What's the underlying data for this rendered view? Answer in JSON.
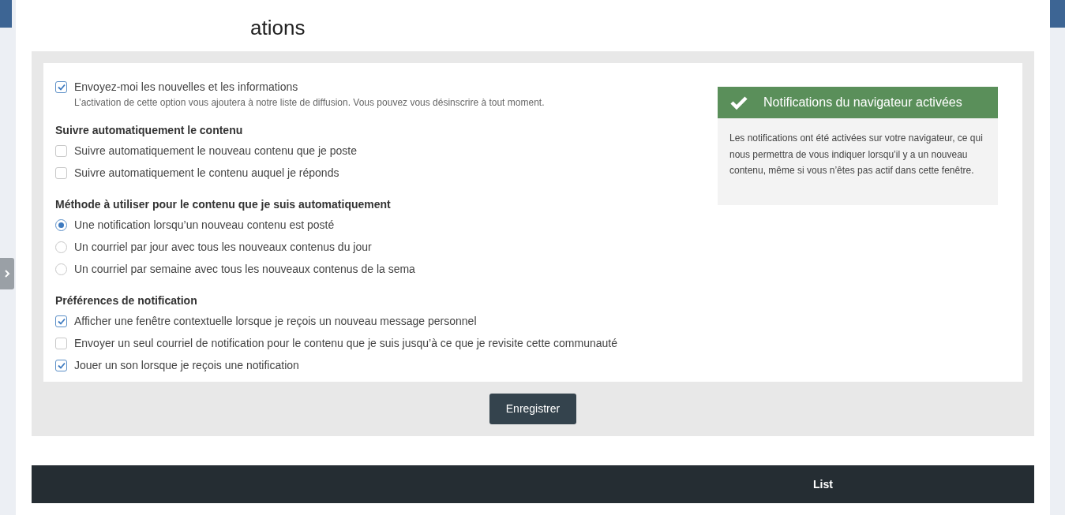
{
  "page_title": "ations",
  "newsletter": {
    "label": "Envoyez-moi les nouvelles et les informations",
    "checked": true,
    "help": "L’activation de cette option vous ajoutera à notre liste de diffusion. Vous pouvez vous désinscrire à tout moment."
  },
  "sections": [
    {
      "heading": "Suivre automatiquement le contenu",
      "options": [
        {
          "kind": "checkbox",
          "label": "Suivre automatiquement le nouveau contenu que je poste",
          "checked": false
        },
        {
          "kind": "checkbox",
          "label": "Suivre automatiquement le contenu auquel je réponds",
          "checked": false
        }
      ]
    },
    {
      "heading": "Méthode à utiliser pour le contenu que je suis automatiquement",
      "options": [
        {
          "kind": "radio",
          "label": "Une notification lorsqu’un nouveau contenu est posté",
          "selected": true
        },
        {
          "kind": "radio",
          "label": "Un courriel par jour avec tous les nouveaux contenus du jour",
          "selected": false
        },
        {
          "kind": "radio",
          "label": "Un courriel par semaine avec tous les nouveaux contenus de la sema",
          "selected": false
        }
      ]
    },
    {
      "heading": "Préférences de notification",
      "options": [
        {
          "kind": "checkbox",
          "label": "Afficher une fenêtre contextuelle lorsque je reçois un nouveau message personnel",
          "checked": true
        },
        {
          "kind": "checkbox",
          "label": "Envoyer un seul courriel de notification pour le contenu que je suis jusqu’à ce que je revisite cette communauté",
          "checked": false
        },
        {
          "kind": "checkbox",
          "label": "Jouer un son lorsque je reçois une notification",
          "checked": true
        }
      ]
    }
  ],
  "browser_notice": {
    "title": "Notifications du navigateur activées",
    "body": "Les notifications ont été activées sur votre navigateur, ce qui nous permettra de vous indiquer lorsqu’il y a un nouveau contenu, même si vous n’êtes pas actif dans cette fenêtre."
  },
  "save_button": "Enregistrer",
  "footer": {
    "link": "List"
  }
}
